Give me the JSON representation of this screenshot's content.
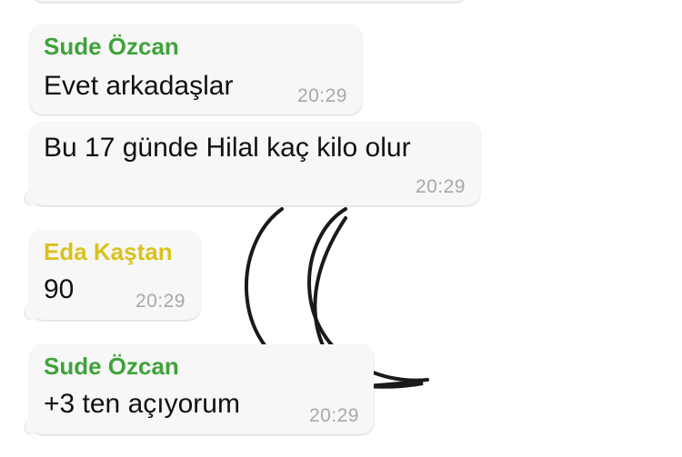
{
  "colors": {
    "bubble": "#f7f7f7",
    "sender_green": "#3fa33a",
    "sender_yellow": "#d9c21c",
    "timestamp": "#a8a8a8",
    "text": "#111111"
  },
  "messages": [
    {
      "sender": "Sude Özcan",
      "sender_color": "#3fa33a",
      "text": "Evet arkadaşlar",
      "time": "20:29"
    },
    {
      "sender": "",
      "text": "Bu 17 günde Hilal kaç kilo olur",
      "time": "20:29"
    },
    {
      "sender": "Eda Kaştan",
      "sender_color": "#d9c21c",
      "text": "90",
      "time": "20:29"
    },
    {
      "sender": "Sude Özcan",
      "sender_color": "#3fa33a",
      "text": "+3 ten açıyorum",
      "time": "20:29"
    }
  ]
}
